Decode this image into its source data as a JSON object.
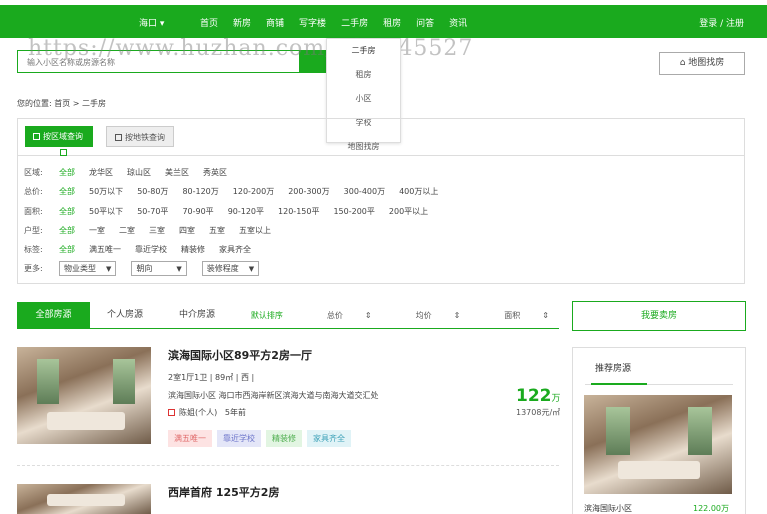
{
  "header": {
    "city": "海口",
    "nav": [
      "首页",
      "新房",
      "商铺",
      "写字楼",
      "二手房",
      "租房",
      "问答",
      "资讯"
    ],
    "login": "登录 / 注册"
  },
  "watermark": "https://www.huzhan.com/ishop45527",
  "search": {
    "placeholder": "输入小区名称或房源名称"
  },
  "dropdown": {
    "items": [
      "二手房",
      "租房",
      "小区",
      "学校",
      "地图找房"
    ]
  },
  "map_button": "地图找房",
  "breadcrumb": "您的位置: 首页 > 二手房",
  "filter_tabs": {
    "area": "按区域查询",
    "metro": "按地铁查询"
  },
  "filters": {
    "district": {
      "label": "区域:",
      "options": [
        "全部",
        "龙华区",
        "琼山区",
        "美兰区",
        "秀英区"
      ]
    },
    "price": {
      "label": "总价:",
      "options": [
        "全部",
        "50万以下",
        "50-80万",
        "80-120万",
        "120-200万",
        "200-300万",
        "300-400万",
        "400万以上"
      ]
    },
    "size": {
      "label": "面积:",
      "options": [
        "全部",
        "50平以下",
        "50-70平",
        "70-90平",
        "90-120平",
        "120-150平",
        "150-200平",
        "200平以上"
      ]
    },
    "layout": {
      "label": "户型:",
      "options": [
        "全部",
        "一室",
        "二室",
        "三室",
        "四室",
        "五室",
        "五室以上"
      ]
    },
    "tags": {
      "label": "标签:",
      "options": [
        "全部",
        "满五唯一",
        "靠近学校",
        "精装修",
        "家具齐全"
      ]
    },
    "more": {
      "label": "更多:",
      "selects": [
        "物业类型",
        "朝向",
        "装修程度"
      ]
    }
  },
  "list_tabs": {
    "all": "全部房源",
    "personal": "个人房源",
    "agency": "中介房源"
  },
  "sorts": [
    "默认排序",
    "总价",
    "均价",
    "面积"
  ],
  "sell_button": "我要卖房",
  "listings": [
    {
      "title": "滨海国际小区89平方2房一厅",
      "specs": "2室1厅1卫 | 89㎡ | 西 |",
      "address": "滨海国际小区 海口市西海岸新区滨海大道与南海大道交汇处",
      "agent": "陈姐(个人)",
      "age": "5年前",
      "tags": [
        "满五唯一",
        "靠近学校",
        "精装修",
        "家具齐全"
      ],
      "price": "122",
      "price_unit": "万",
      "unit_price": "13708元/㎡"
    },
    {
      "title": "西岸首府 125平方2房"
    }
  ],
  "recommend": {
    "title": "推荐房源",
    "caption": "滨海国际小区",
    "price": "122.00万"
  },
  "colors": {
    "brand": "#1aaa1e"
  }
}
